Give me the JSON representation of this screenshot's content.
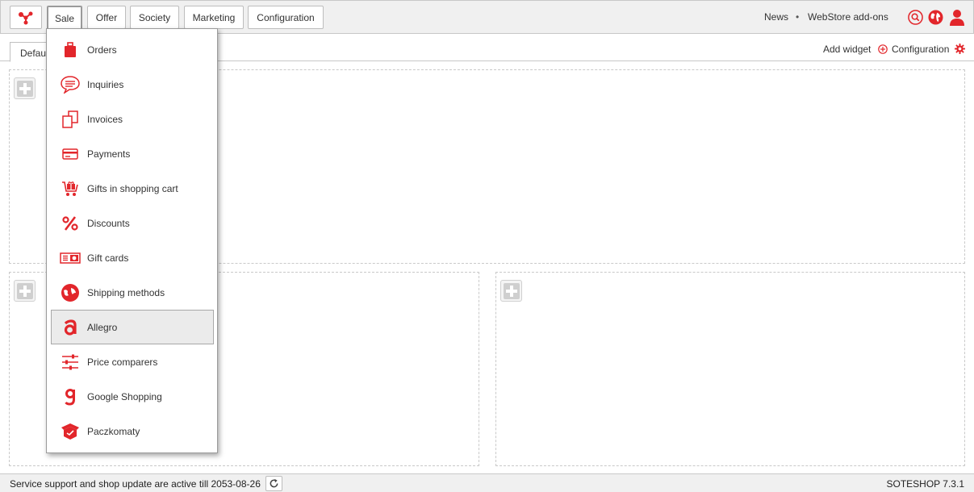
{
  "nav": {
    "tabs": [
      {
        "label": "Sale"
      },
      {
        "label": "Offer"
      },
      {
        "label": "Society"
      },
      {
        "label": "Marketing"
      },
      {
        "label": "Configuration"
      }
    ],
    "news": "News",
    "separator": "•",
    "addons": "WebStore add-ons"
  },
  "toolbar": {
    "default_tab": "Default",
    "add_widget": "Add widget",
    "configuration": "Configuration"
  },
  "dropdown": {
    "items": [
      {
        "label": "Orders",
        "icon": "bag-icon"
      },
      {
        "label": "Inquiries",
        "icon": "chat-icon"
      },
      {
        "label": "Invoices",
        "icon": "documents-icon"
      },
      {
        "label": "Payments",
        "icon": "card-icon"
      },
      {
        "label": "Gifts in shopping cart",
        "icon": "gift-cart-icon"
      },
      {
        "label": "Discounts",
        "icon": "percent-icon"
      },
      {
        "label": "Gift cards",
        "icon": "gift-card-icon"
      },
      {
        "label": "Shipping methods",
        "icon": "shipping-icon"
      },
      {
        "label": "Allegro",
        "icon": "allegro-icon"
      },
      {
        "label": "Price comparers",
        "icon": "sliders-icon"
      },
      {
        "label": "Google Shopping",
        "icon": "google-icon"
      },
      {
        "label": "Paczkomaty",
        "icon": "parcel-icon"
      }
    ],
    "hovered_index": 8
  },
  "footer": {
    "status": "Service support and shop update are active till 2053-08-26",
    "version": "SOTESHOP 7.3.1"
  },
  "colors": {
    "accent": "#e2262b",
    "bar": "#f0f0f0",
    "border": "#c8c8c8"
  }
}
